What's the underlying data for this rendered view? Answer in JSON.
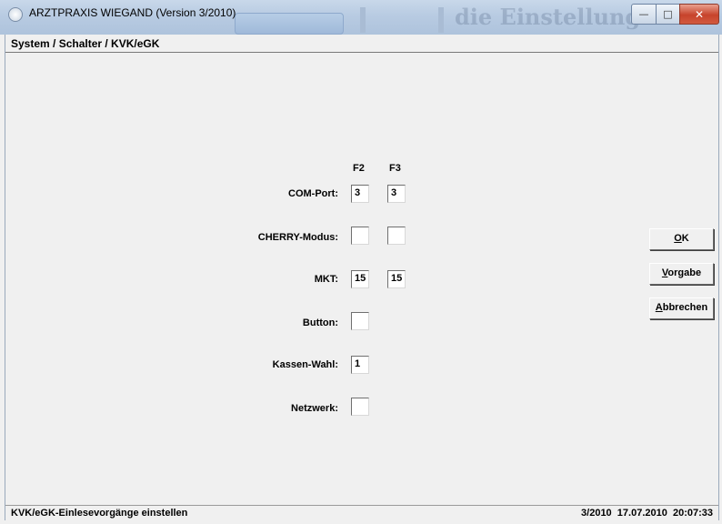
{
  "window": {
    "title": "ARZTPRAXIS WIEGAND (Version 3/2010)",
    "background_title_fragment": "die Einstellung",
    "controls": {
      "minimize": "—",
      "maximize": "□",
      "close": "✕"
    }
  },
  "header": {
    "breadcrumb": "System / Schalter / KVK/eGK"
  },
  "columns": [
    "F2",
    "F3"
  ],
  "rows": [
    {
      "label": "COM-Port:",
      "f2": "3",
      "f3": "3"
    },
    {
      "label": "CHERRY-Modus:",
      "f2": "",
      "f3": ""
    },
    {
      "label": "MKT:",
      "f2": "15",
      "f3": "15"
    },
    {
      "label": "Button:",
      "f2": ""
    },
    {
      "label": "Kassen-Wahl:",
      "f2": "1"
    },
    {
      "label": "Netzwerk:",
      "f2": ""
    }
  ],
  "buttons": {
    "ok": {
      "accel": "O",
      "rest": "K"
    },
    "vorgabe": {
      "accel": "V",
      "rest": "orgabe"
    },
    "abbrechen": {
      "accel": "A",
      "rest": "bbrechen"
    }
  },
  "status": {
    "left": "KVK/eGK-Einlesevorgänge einstellen",
    "right": "3/2010  17.07.2010  20:07:33"
  },
  "colors": {
    "face": "#f0f0f0",
    "titlebar": "#b8cbe2",
    "close": "#c7432c"
  }
}
